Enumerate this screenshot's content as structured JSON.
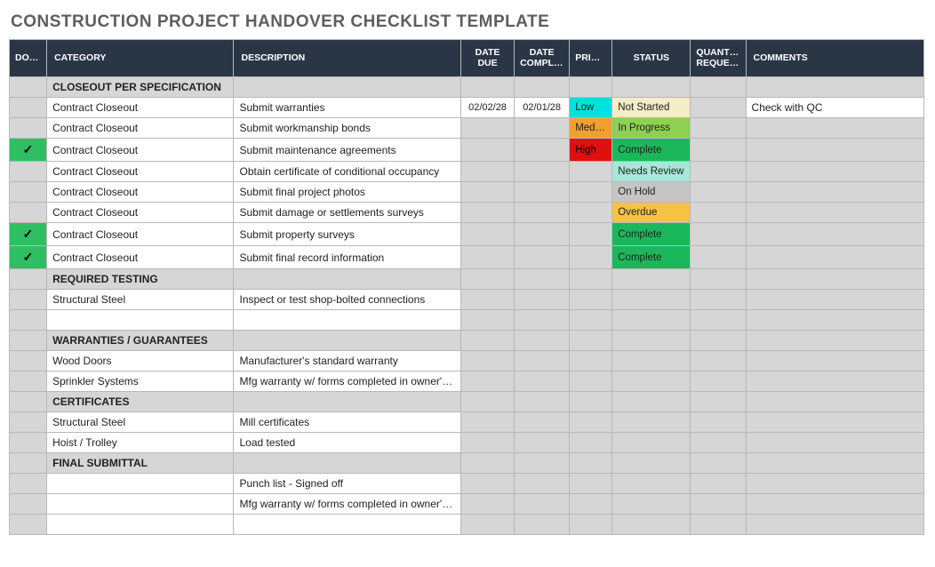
{
  "title": "CONSTRUCTION PROJECT HANDOVER CHECKLIST TEMPLATE",
  "headers": {
    "done": "DONE",
    "category": "CATEGORY",
    "description": "DESCRIPTION",
    "date_due": "DATE DUE",
    "date_completed": "DATE COMPLETED",
    "priority": "PRIORITY",
    "status": "STATUS",
    "quantity_requested": "QUANTITY REQUESTED",
    "comments": "COMMENTS"
  },
  "rows": [
    {
      "type": "section",
      "label": "CLOSEOUT PER SPECIFICATION"
    },
    {
      "type": "item",
      "done": false,
      "category": "Contract Closeout",
      "description": "Submit warranties",
      "date_due": "02/02/28",
      "date_completed": "02/01/28",
      "priority": "Low",
      "status": "Not Started",
      "quantity_requested": "",
      "comments": "Check with QC"
    },
    {
      "type": "item",
      "done": false,
      "category": "Contract Closeout",
      "description": "Submit workmanship bonds",
      "date_due": "",
      "date_completed": "",
      "priority": "Medium",
      "status": "In Progress",
      "quantity_requested": "",
      "comments": ""
    },
    {
      "type": "item",
      "done": true,
      "category": "Contract Closeout",
      "description": "Submit maintenance agreements",
      "date_due": "",
      "date_completed": "",
      "priority": "High",
      "status": "Complete",
      "quantity_requested": "",
      "comments": ""
    },
    {
      "type": "item",
      "done": false,
      "category": "Contract Closeout",
      "description": "Obtain certificate of conditional occupancy",
      "date_due": "",
      "date_completed": "",
      "priority": "",
      "status": "Needs Review",
      "quantity_requested": "",
      "comments": ""
    },
    {
      "type": "item",
      "done": false,
      "category": "Contract Closeout",
      "description": "Submit final project photos",
      "date_due": "",
      "date_completed": "",
      "priority": "",
      "status": "On Hold",
      "quantity_requested": "",
      "comments": ""
    },
    {
      "type": "item",
      "done": false,
      "category": "Contract Closeout",
      "description": "Submit damage or settlements surveys",
      "date_due": "",
      "date_completed": "",
      "priority": "",
      "status": "Overdue",
      "quantity_requested": "",
      "comments": ""
    },
    {
      "type": "item",
      "done": true,
      "category": "Contract Closeout",
      "description": "Submit property surveys",
      "date_due": "",
      "date_completed": "",
      "priority": "",
      "status": "Complete",
      "quantity_requested": "",
      "comments": ""
    },
    {
      "type": "item",
      "done": true,
      "category": "Contract Closeout",
      "description": "Submit final record information",
      "date_due": "",
      "date_completed": "",
      "priority": "",
      "status": "Complete",
      "quantity_requested": "",
      "comments": ""
    },
    {
      "type": "section",
      "label": "REQUIRED TESTING"
    },
    {
      "type": "item",
      "done": false,
      "category": "Structural Steel",
      "description": "Inspect or test shop-bolted connections",
      "date_due": "",
      "date_completed": "",
      "priority": "",
      "status": "",
      "quantity_requested": "",
      "comments": ""
    },
    {
      "type": "blank"
    },
    {
      "type": "section",
      "label": "WARRANTIES / GUARANTEES"
    },
    {
      "type": "item",
      "done": false,
      "category": "Wood Doors",
      "description": "Manufacturer's standard warranty",
      "date_due": "",
      "date_completed": "",
      "priority": "",
      "status": "",
      "quantity_requested": "",
      "comments": ""
    },
    {
      "type": "item",
      "done": false,
      "category": "Sprinkler Systems",
      "description": "Mfg warranty w/ forms completed in owner's name",
      "date_due": "",
      "date_completed": "",
      "priority": "",
      "status": "",
      "quantity_requested": "",
      "comments": ""
    },
    {
      "type": "section",
      "label": "CERTIFICATES"
    },
    {
      "type": "item",
      "done": false,
      "category": "Structural Steel",
      "description": "Mill certificates",
      "date_due": "",
      "date_completed": "",
      "priority": "",
      "status": "",
      "quantity_requested": "",
      "comments": ""
    },
    {
      "type": "item",
      "done": false,
      "category": "Hoist / Trolley",
      "description": "Load tested",
      "date_due": "",
      "date_completed": "",
      "priority": "",
      "status": "",
      "quantity_requested": "",
      "comments": ""
    },
    {
      "type": "section",
      "label": "FINAL SUBMITTAL"
    },
    {
      "type": "item",
      "done": false,
      "category": "",
      "description": "Punch list - Signed off",
      "date_due": "",
      "date_completed": "",
      "priority": "",
      "status": "",
      "quantity_requested": "",
      "comments": ""
    },
    {
      "type": "item",
      "done": false,
      "category": "",
      "description": "Mfg warranty w/ forms completed in owner's name",
      "date_due": "",
      "date_completed": "",
      "priority": "",
      "status": "",
      "quantity_requested": "",
      "comments": ""
    },
    {
      "type": "blank"
    }
  ],
  "status_class_map": {
    "Not Started": "stat-not-started",
    "In Progress": "stat-in-progress",
    "Complete": "stat-complete",
    "Needs Review": "stat-needs-review",
    "On Hold": "stat-on-hold",
    "Overdue": "stat-overdue"
  },
  "check_glyph": "✓"
}
